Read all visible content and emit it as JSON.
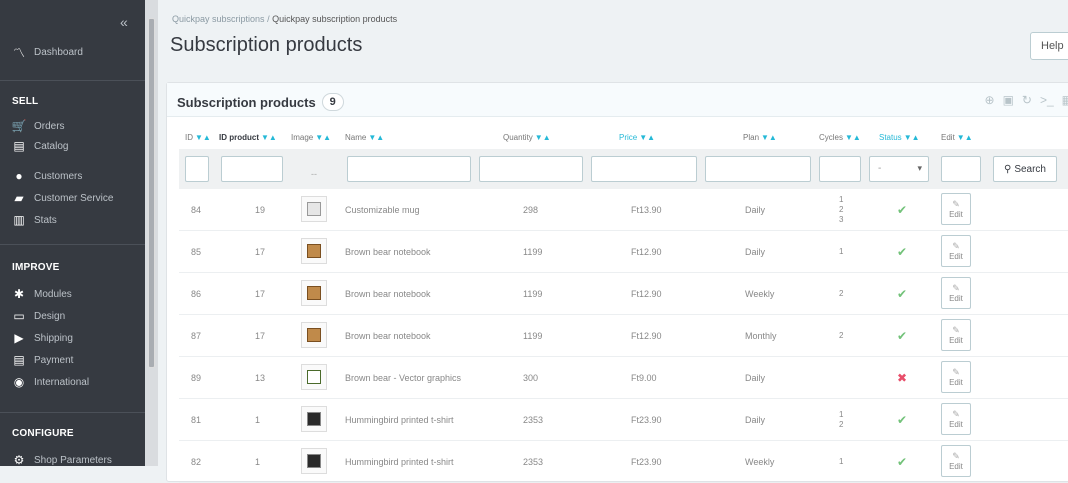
{
  "sidebar": {
    "collapse_label": "«",
    "dashboard": "Dashboard",
    "sections": [
      {
        "title": "SELL",
        "items": [
          "Orders",
          "Catalog",
          "Customers",
          "Customer Service",
          "Stats"
        ]
      },
      {
        "title": "IMPROVE",
        "items": [
          "Modules",
          "Design",
          "Shipping",
          "Payment",
          "International"
        ]
      },
      {
        "title": "CONFIGURE",
        "items": [
          "Shop Parameters"
        ]
      }
    ]
  },
  "breadcrumb": {
    "parent": "Quickpay subscriptions",
    "separator": "/",
    "current": "Quickpay subscription products"
  },
  "page_title": "Subscription products",
  "help_label": "Help",
  "panel": {
    "title": "Subscription products",
    "count": "9"
  },
  "columns": [
    "ID",
    "ID product",
    "Image",
    "Name",
    "Quantity",
    "Price",
    "Plan",
    "Cycles",
    "Status",
    "Edit"
  ],
  "filter": {
    "status_select": "-",
    "search_label": "Search",
    "image_placeholder": "--"
  },
  "rows": [
    {
      "id": "84",
      "id_product": "19",
      "name": "Customizable mug",
      "quantity": "298",
      "price": "Ft13.90",
      "plan": "Daily",
      "cycles": [
        "1",
        "2",
        "3"
      ],
      "status": "active",
      "edit": "Edit"
    },
    {
      "id": "85",
      "id_product": "17",
      "name": "Brown bear notebook",
      "quantity": "1199",
      "price": "Ft12.90",
      "plan": "Daily",
      "cycles": [
        "1"
      ],
      "status": "active",
      "edit": "Edit"
    },
    {
      "id": "86",
      "id_product": "17",
      "name": "Brown bear notebook",
      "quantity": "1199",
      "price": "Ft12.90",
      "plan": "Weekly",
      "cycles": [
        "2"
      ],
      "status": "active",
      "edit": "Edit"
    },
    {
      "id": "87",
      "id_product": "17",
      "name": "Brown bear notebook",
      "quantity": "1199",
      "price": "Ft12.90",
      "plan": "Monthly",
      "cycles": [
        "2"
      ],
      "status": "active",
      "edit": "Edit"
    },
    {
      "id": "89",
      "id_product": "13",
      "name": "Brown bear - Vector graphics",
      "quantity": "300",
      "price": "Ft9.00",
      "plan": "Daily",
      "cycles": [],
      "status": "inactive",
      "edit": "Edit"
    },
    {
      "id": "81",
      "id_product": "1",
      "name": "Hummingbird printed t-shirt",
      "quantity": "2353",
      "price": "Ft23.90",
      "plan": "Daily",
      "cycles": [
        "1",
        "2"
      ],
      "status": "active",
      "edit": "Edit"
    },
    {
      "id": "82",
      "id_product": "1",
      "name": "Hummingbird printed t-shirt",
      "quantity": "2353",
      "price": "Ft23.90",
      "plan": "Weekly",
      "cycles": [
        "1"
      ],
      "status": "active",
      "edit": "Edit"
    }
  ],
  "colors": {
    "accent": "#25b9d7",
    "sidebar_bg": "#363a41",
    "active_check": "#72c279",
    "inactive_x": "#e84e6a"
  }
}
